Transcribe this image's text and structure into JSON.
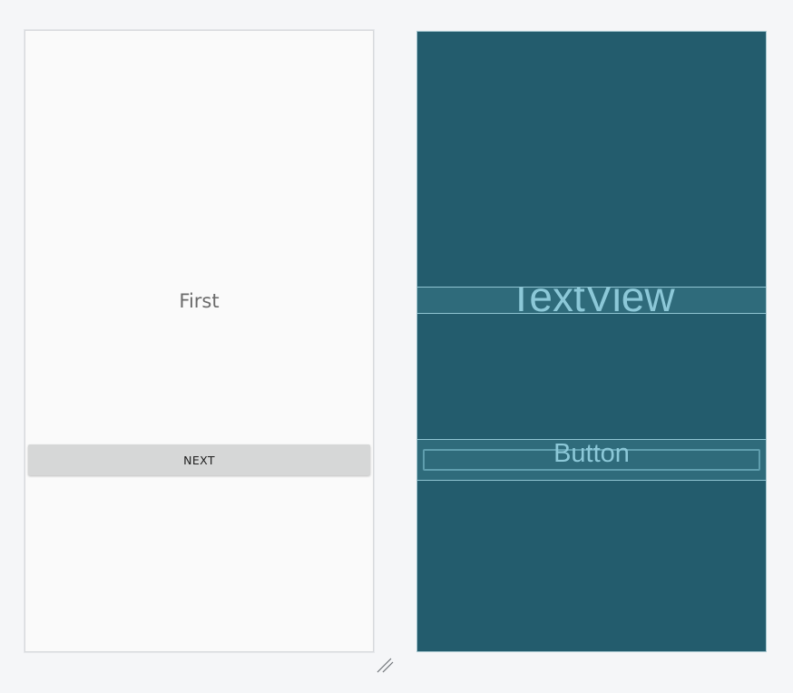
{
  "design_preview": {
    "text_view": "First",
    "next_button": "NEXT"
  },
  "blueprint_preview": {
    "text_view_label": "TextView",
    "button_label": "Button"
  },
  "colors": {
    "canvas_background": "#f5f6f8",
    "design_background": "#fafafa",
    "blueprint_background": "#235c6d",
    "blueprint_highlight": "#2f6b7b",
    "blueprint_text": "#8cc8d8",
    "button_background": "#d6d7d7"
  },
  "icons": {
    "resize_handle": "resize-handle-icon"
  }
}
